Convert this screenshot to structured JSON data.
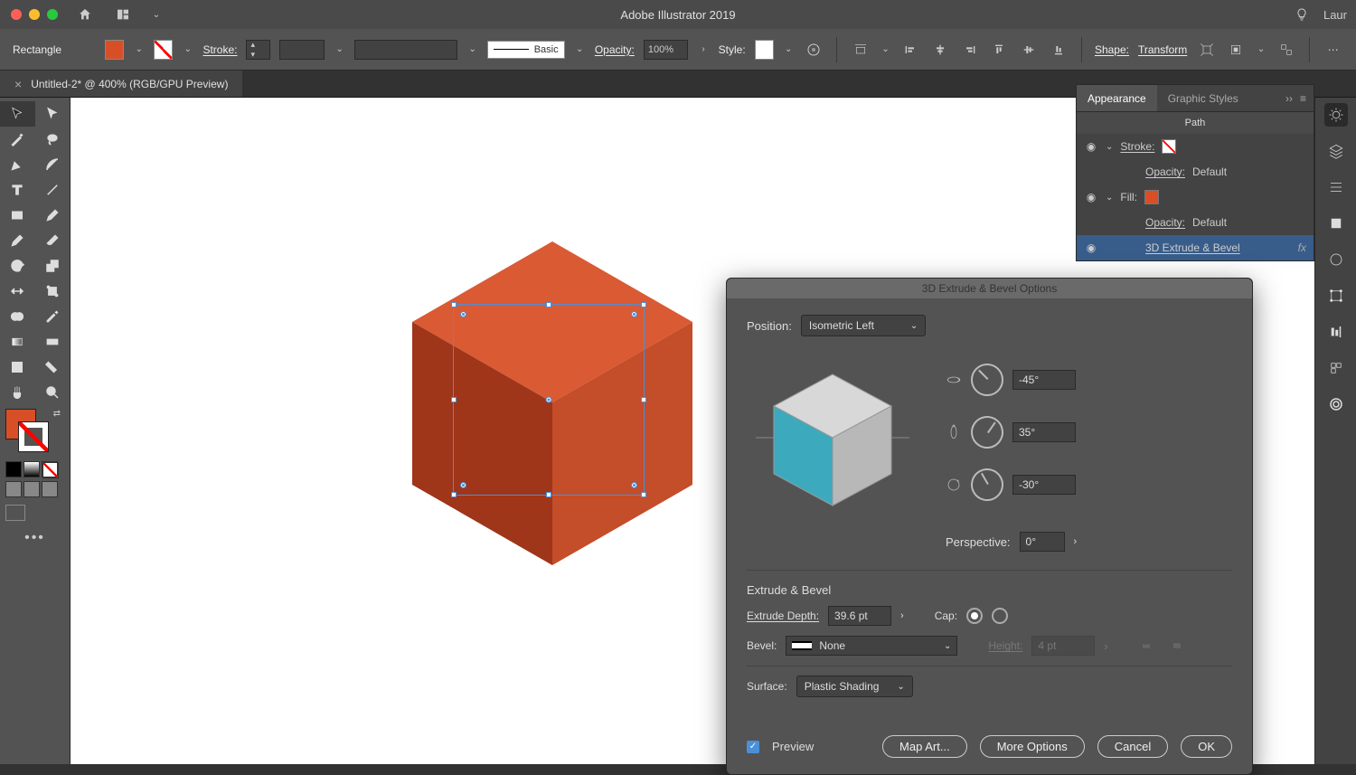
{
  "app": {
    "title": "Adobe Illustrator 2019",
    "user": "Laur"
  },
  "controlbar": {
    "shape_label": "Rectangle",
    "stroke_label": "Stroke:",
    "stroke_style_label": "Basic",
    "opacity_label": "Opacity:",
    "opacity_value": "100%",
    "style_label": "Style:",
    "shape_link": "Shape:",
    "transform_link": "Transform",
    "fill_color": "#d84f27"
  },
  "tab": {
    "name": "Untitled-2* @ 400% (RGB/GPU Preview)"
  },
  "appearance": {
    "tab1": "Appearance",
    "tab2": "Graphic Styles",
    "header": "Path",
    "stroke_label": "Stroke:",
    "opacity_label": "Opacity:",
    "opacity_value": "Default",
    "fill_label": "Fill:",
    "effect_label": "3D Extrude & Bevel"
  },
  "dialog": {
    "title": "3D Extrude & Bevel Options",
    "position_label": "Position:",
    "position_value": "Isometric Left",
    "rot_x": "-45°",
    "rot_y": "35°",
    "rot_z": "-30°",
    "perspective_label": "Perspective:",
    "perspective_value": "0°",
    "section_extrude": "Extrude & Bevel",
    "depth_label": "Extrude Depth:",
    "depth_value": "39.6 pt",
    "cap_label": "Cap:",
    "bevel_label": "Bevel:",
    "bevel_value": "None",
    "height_label": "Height:",
    "height_value": "4 pt",
    "surface_label": "Surface:",
    "surface_value": "Plastic Shading",
    "preview_label": "Preview",
    "btn_map": "Map Art...",
    "btn_more": "More Options",
    "btn_cancel": "Cancel",
    "btn_ok": "OK"
  }
}
